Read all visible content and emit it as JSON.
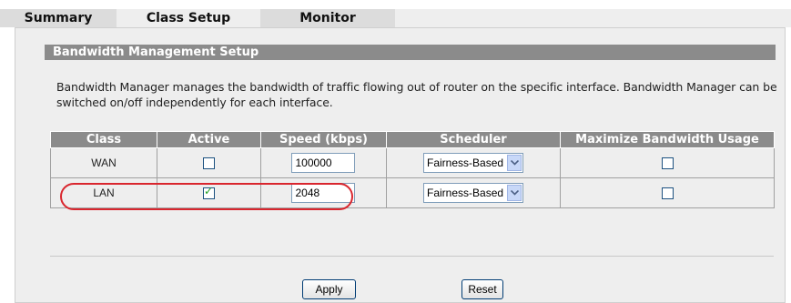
{
  "tabs": [
    {
      "label": "Summary"
    },
    {
      "label": "Class Setup"
    },
    {
      "label": "Monitor"
    }
  ],
  "section": {
    "title": "Bandwidth Management Setup",
    "description": "Bandwidth Manager manages the bandwidth of traffic flowing out of router on the specific interface. Bandwidth Manager can be switched on/off independently for each interface."
  },
  "table": {
    "headers": [
      "Class",
      "Active",
      "Speed (kbps)",
      "Scheduler",
      "Maximize Bandwidth Usage"
    ],
    "rows": [
      {
        "class": "WAN",
        "active": false,
        "speed": "100000",
        "scheduler": "Fairness-Based",
        "maximize": false
      },
      {
        "class": "LAN",
        "active": true,
        "speed": "2048",
        "scheduler": "Fairness-Based",
        "maximize": false
      }
    ]
  },
  "buttons": {
    "apply": "Apply",
    "reset": "Reset"
  },
  "colors": {
    "highlight": "#d9262e",
    "header_bg": "#8b8b8b",
    "panel_bg": "#eeeeee"
  }
}
